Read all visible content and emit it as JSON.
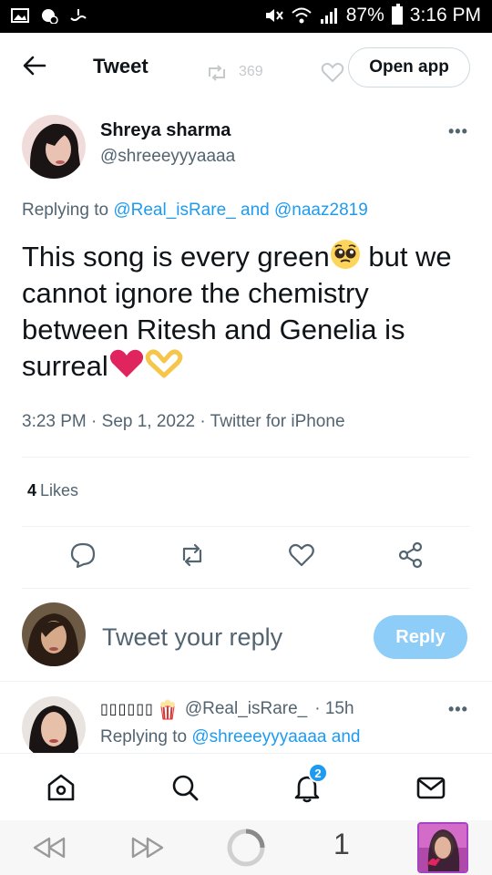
{
  "status_bar": {
    "battery": "87%",
    "time": "3:16 PM"
  },
  "header": {
    "title": "Tweet",
    "background_retweets": "369",
    "open_app_label": "Open app"
  },
  "tweet": {
    "author_name": "Shreya sharma",
    "author_handle": "@shreeeyyyaaaa",
    "replying_prefix": "Replying to",
    "reply_to_1": "@Real_isRare_",
    "reply_join": "and",
    "reply_to_2": "@naaz2819",
    "text_part1": "This song is every green",
    "text_part2": " but we cannot ignore the chemistry between Ritesh and Genelia is surreal",
    "timestamp": "3:23 PM · Sep 1, 2022 · Twitter for iPhone",
    "likes_count": "4",
    "likes_label": "Likes"
  },
  "composer": {
    "placeholder": "Tweet your reply",
    "reply_button": "Reply"
  },
  "next_reply": {
    "display_name": "▯▯▯▯▯▯",
    "handle": "@Real_isRare_",
    "time": "· 15h",
    "replying_prefix": "Replying to",
    "reply_to": "@shreeeyyyaaaa",
    "reply_join": "and"
  },
  "bottom_nav": {
    "notification_badge": "2"
  },
  "browser": {
    "tab_count": "1"
  },
  "colors": {
    "link": "#1d9bf0",
    "secondary_text": "#536471",
    "reply_button": "#8ecdf8",
    "heart": "#e0245e"
  }
}
